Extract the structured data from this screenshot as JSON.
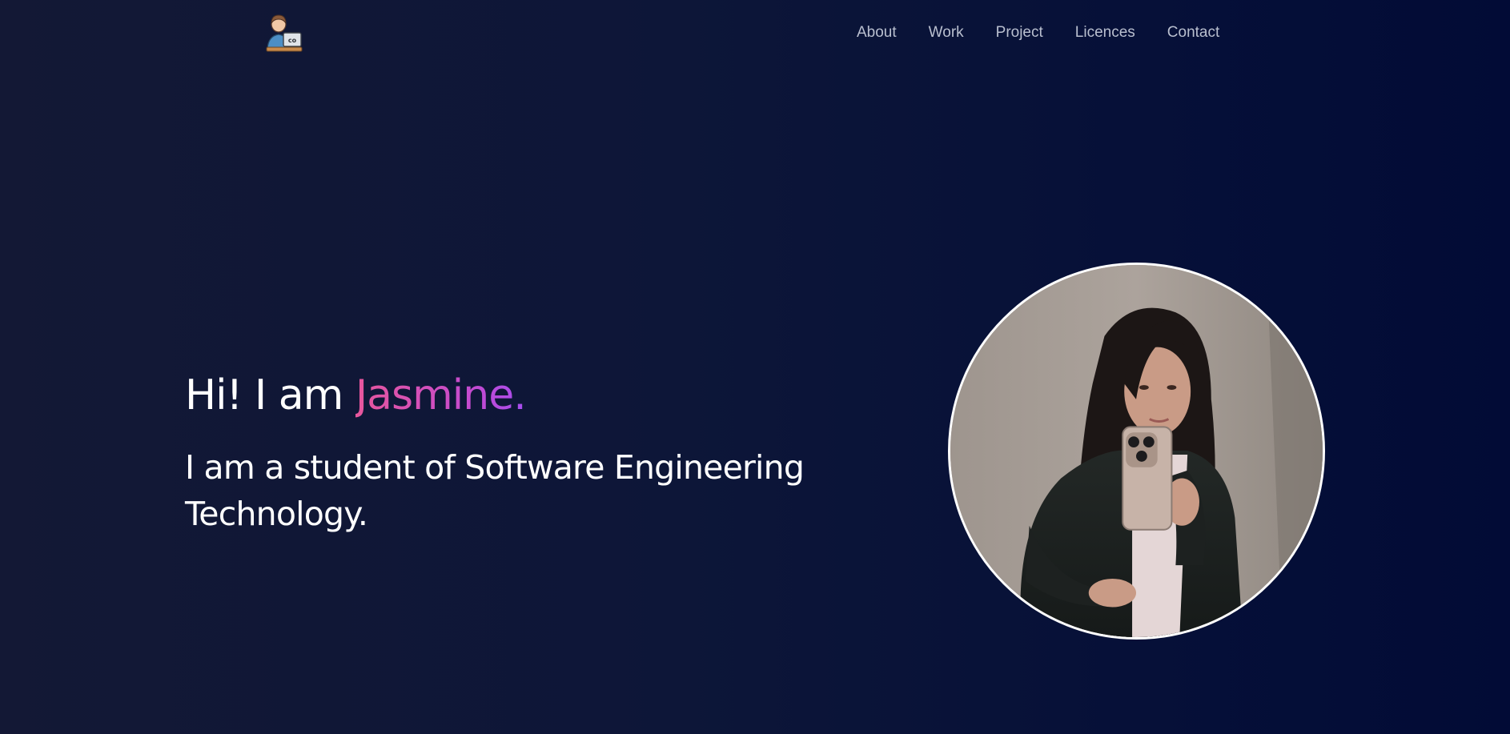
{
  "header": {
    "logo_icon": "developer-avatar-icon",
    "nav": [
      {
        "label": "About"
      },
      {
        "label": "Work"
      },
      {
        "label": "Project"
      },
      {
        "label": "Licences"
      },
      {
        "label": "Contact"
      }
    ]
  },
  "hero": {
    "greeting": "Hi! I am ",
    "name": "Jasmine.",
    "subtitle": "I am a student of Software Engineering Technology.",
    "photo_icon": "profile-photo"
  },
  "colors": {
    "background_start": "#131835",
    "background_end": "#020b36",
    "nav_text": "#b9bfcf",
    "name_gradient_start": "#e8579c",
    "name_gradient_end": "#a64df0"
  }
}
